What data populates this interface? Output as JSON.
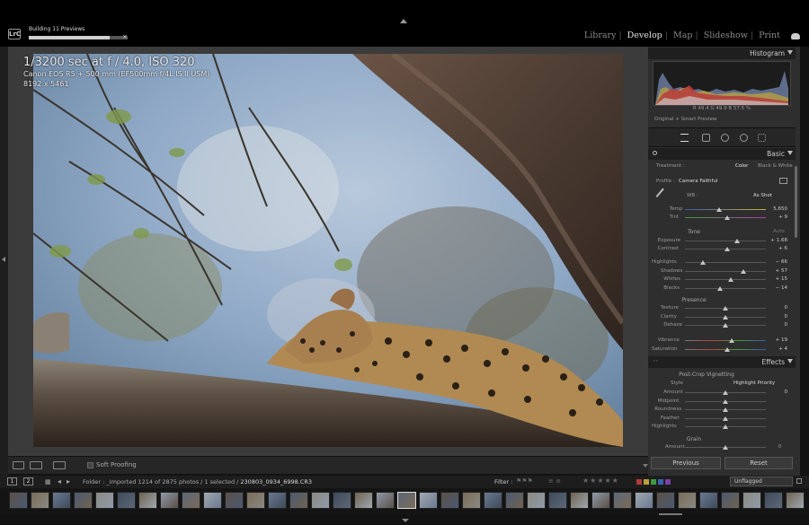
{
  "top": {
    "logo": "LrC",
    "building_label": "Building 11 Previews",
    "building_progress": 0.82,
    "modules": [
      "Library",
      "Develop",
      "Map",
      "Slideshow",
      "Print"
    ],
    "active_module": "Develop"
  },
  "photo_info": {
    "line1": "1/3200 sec at f / 4.0, ISO 320",
    "line2": "Canon EOS R5 + 500 mm (EF500mm f/4L IS II USM)",
    "line3": "8192 x 5461"
  },
  "toolbar": {
    "soft_proofing": "Soft Proofing"
  },
  "histogram": {
    "title": "Histogram",
    "readout": "R  49.4   G  49.9   B  57.5  %",
    "preview_mode": "Original + Smart Preview"
  },
  "basic": {
    "title": "Basic",
    "treatment_label": "Treatment :",
    "treatment_color": "Color",
    "treatment_bw": "Black & White",
    "profile_label": "Profile :",
    "profile_value": "Camera Faithful",
    "wb_label": "WB :",
    "wb_value": "As Shot",
    "tone_label": "Tone",
    "auto_label": "Auto",
    "presence_label": "Presence",
    "sliders_wb": [
      {
        "name": "Temp",
        "value": "5,650",
        "pos": 0.42
      },
      {
        "name": "Tint",
        "value": "+ 9",
        "pos": 0.52
      }
    ],
    "sliders_tone": [
      {
        "name": "Exposure",
        "value": "+ 1.68",
        "pos": 0.64
      },
      {
        "name": "Contrast",
        "value": "+ 6",
        "pos": 0.52
      }
    ],
    "sliders_tone2": [
      {
        "name": "Highlights",
        "value": "− 66",
        "pos": 0.22
      },
      {
        "name": "Shadows",
        "value": "+ 57",
        "pos": 0.72
      },
      {
        "name": "Whites",
        "value": "+ 15",
        "pos": 0.57
      },
      {
        "name": "Blacks",
        "value": "− 14",
        "pos": 0.43
      }
    ],
    "sliders_presence": [
      {
        "name": "Texture",
        "value": "0",
        "pos": 0.5
      },
      {
        "name": "Clarity",
        "value": "0",
        "pos": 0.5
      },
      {
        "name": "Dehaze",
        "value": "0",
        "pos": 0.5
      }
    ],
    "sliders_vib": [
      {
        "name": "Vibrance",
        "value": "+ 19",
        "pos": 0.58
      },
      {
        "name": "Saturation",
        "value": "+ 4",
        "pos": 0.52
      }
    ]
  },
  "effects": {
    "title": "Effects",
    "vignette_title": "Post-Crop Vignetting",
    "style_label": "Style",
    "style_value": "Highlight Priority",
    "sliders": [
      {
        "name": "Amount",
        "value": "0",
        "pos": 0.5
      },
      {
        "name": "Midpoint",
        "value": "",
        "pos": 0.5
      },
      {
        "name": "Roundness",
        "value": "",
        "pos": 0.5
      },
      {
        "name": "Feather",
        "value": "",
        "pos": 0.5
      },
      {
        "name": "Highlights",
        "value": "",
        "pos": 0.5
      }
    ],
    "grain_title": "Grain",
    "grain_amount_label": "Amount",
    "grain_amount_value": "0"
  },
  "buttons": {
    "previous": "Previous",
    "reset": "Reset"
  },
  "filmstrip": {
    "screen1": "1",
    "screen2": "2",
    "folder_label": "Folder : _Imported",
    "count_text": "1214 of 2875 photos / 1 selected / ",
    "filename": "230803_0934_6998.CR3",
    "filter_label": "Filter :",
    "stars": "★★★★★",
    "flag_filter": "Unflagged",
    "color_labels": [
      "#b33a3a",
      "#b8a236",
      "#3f9a3f",
      "#3a64b0",
      "#7d3fa8"
    ]
  }
}
